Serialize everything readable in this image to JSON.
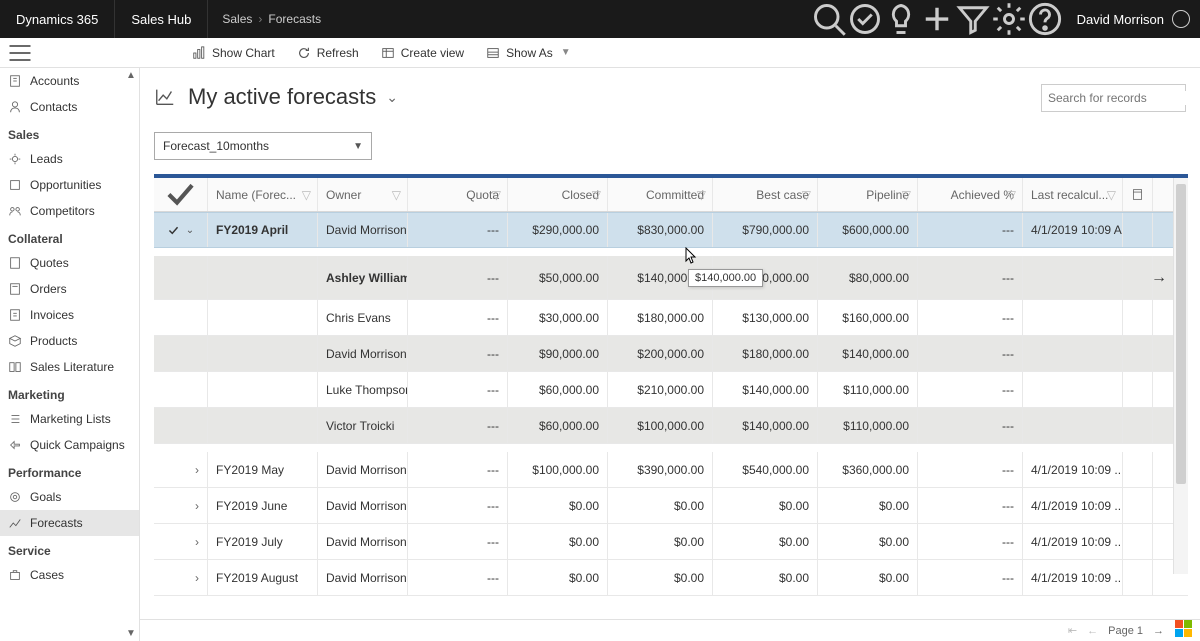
{
  "header": {
    "brand": "Dynamics 365",
    "hub": "Sales Hub",
    "crumb1": "Sales",
    "crumb2": "Forecasts",
    "user": "David Morrison"
  },
  "cmdbar": {
    "show_chart": "Show Chart",
    "refresh": "Refresh",
    "create_view": "Create view",
    "show_as": "Show As"
  },
  "sidebar": {
    "item_accounts": "Accounts",
    "item_contacts": "Contacts",
    "group_sales": "Sales",
    "item_leads": "Leads",
    "item_opps": "Opportunities",
    "item_comp": "Competitors",
    "group_collateral": "Collateral",
    "item_quotes": "Quotes",
    "item_orders": "Orders",
    "item_invoices": "Invoices",
    "item_products": "Products",
    "item_saleslit": "Sales Literature",
    "group_marketing": "Marketing",
    "item_mlists": "Marketing Lists",
    "item_qcamp": "Quick Campaigns",
    "group_perf": "Performance",
    "item_goals": "Goals",
    "item_forecasts": "Forecasts",
    "group_service": "Service",
    "item_cases": "Cases"
  },
  "page": {
    "title": "My active forecasts",
    "search_placeholder": "Search for records",
    "period": "Forecast_10months"
  },
  "columns": {
    "name": "Name (Forec...",
    "owner": "Owner",
    "quota": "Quota",
    "closed": "Closed",
    "committed": "Committed",
    "best": "Best case",
    "pipeline": "Pipeline",
    "achieved": "Achieved %",
    "last": "Last recalcul..."
  },
  "rows": [
    {
      "name": "FY2019 April",
      "owner": "David Morrison",
      "quota": "---",
      "closed": "$290,000.00",
      "committed": "$830,000.00",
      "best": "$790,000.00",
      "pipeline": "$600,000.00",
      "achieved": "---",
      "last": "4/1/2019 10:09 A..."
    },
    {
      "name": "",
      "owner": "Ashley Williams",
      "quota": "---",
      "closed": "$50,000.00",
      "committed": "$140,000.00",
      "best": "$200,000.00",
      "pipeline": "$80,000.00",
      "achieved": "---",
      "last": ""
    },
    {
      "name": "",
      "owner": "Chris Evans",
      "quota": "---",
      "closed": "$30,000.00",
      "committed": "$180,000.00",
      "best": "$130,000.00",
      "pipeline": "$160,000.00",
      "achieved": "---",
      "last": ""
    },
    {
      "name": "",
      "owner": "David Morrison",
      "quota": "---",
      "closed": "$90,000.00",
      "committed": "$200,000.00",
      "best": "$180,000.00",
      "pipeline": "$140,000.00",
      "achieved": "---",
      "last": ""
    },
    {
      "name": "",
      "owner": "Luke Thompson",
      "quota": "---",
      "closed": "$60,000.00",
      "committed": "$210,000.00",
      "best": "$140,000.00",
      "pipeline": "$110,000.00",
      "achieved": "---",
      "last": ""
    },
    {
      "name": "",
      "owner": "Victor Troicki",
      "quota": "---",
      "closed": "$60,000.00",
      "committed": "$100,000.00",
      "best": "$140,000.00",
      "pipeline": "$110,000.00",
      "achieved": "---",
      "last": ""
    },
    {
      "name": "FY2019 May",
      "owner": "David Morrison",
      "quota": "---",
      "closed": "$100,000.00",
      "committed": "$390,000.00",
      "best": "$540,000.00",
      "pipeline": "$360,000.00",
      "achieved": "---",
      "last": "4/1/2019 10:09 ..."
    },
    {
      "name": "FY2019 June",
      "owner": "David Morrison",
      "quota": "---",
      "closed": "$0.00",
      "committed": "$0.00",
      "best": "$0.00",
      "pipeline": "$0.00",
      "achieved": "---",
      "last": "4/1/2019 10:09 ..."
    },
    {
      "name": "FY2019 July",
      "owner": "David Morrison",
      "quota": "---",
      "closed": "$0.00",
      "committed": "$0.00",
      "best": "$0.00",
      "pipeline": "$0.00",
      "achieved": "---",
      "last": "4/1/2019 10:09 ..."
    },
    {
      "name": "FY2019 August",
      "owner": "David Morrison",
      "quota": "---",
      "closed": "$0.00",
      "committed": "$0.00",
      "best": "$0.00",
      "pipeline": "$0.00",
      "achieved": "---",
      "last": "4/1/2019 10:09 ..."
    }
  ],
  "tooltip": "$140,000.00",
  "footer": {
    "page": "Page 1"
  }
}
